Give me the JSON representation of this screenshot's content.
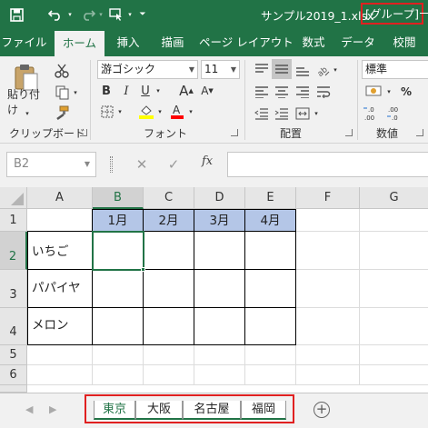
{
  "titlebar": {
    "file_name": "サンプル2019_1.xlsx",
    "group_tag": "[グループ]"
  },
  "qat_icons": [
    "save-icon",
    "undo-icon",
    "redo-icon",
    "touch-mode-icon",
    "customize-qat-icon"
  ],
  "tabs": [
    {
      "label": "ファイル"
    },
    {
      "label": "ホーム",
      "active": true
    },
    {
      "label": "挿入"
    },
    {
      "label": "描画"
    },
    {
      "label": "ページ レイアウト"
    },
    {
      "label": "数式"
    },
    {
      "label": "データ"
    },
    {
      "label": "校閲"
    }
  ],
  "ribbon": {
    "clipboard": {
      "label": "クリップボード",
      "paste_label": "貼り付け"
    },
    "font": {
      "label": "フォント",
      "font_name": "游ゴシック",
      "font_size": "11",
      "bold": "B",
      "italic": "I",
      "underline": "U",
      "grow": "A",
      "shrink": "A"
    },
    "alignment": {
      "label": "配置"
    },
    "number": {
      "label": "数値",
      "format": "標準"
    },
    "colors": {
      "accent": "#217346",
      "highlight": "#ffff00",
      "font_color": "#ff0000",
      "header_fill": "#b4c6e7"
    }
  },
  "formula_bar": {
    "name_box": "B2",
    "fx": "fx",
    "formula": ""
  },
  "columns": [
    "A",
    "B",
    "C",
    "D",
    "E",
    "F",
    "G"
  ],
  "rows": [
    "1",
    "2",
    "3",
    "4",
    "5",
    "6"
  ],
  "selected": {
    "column": "B",
    "row": "2"
  },
  "table": {
    "headers": [
      "1月",
      "2月",
      "3月",
      "4月"
    ],
    "items": [
      "いちご",
      "パパイヤ",
      "メロン"
    ]
  },
  "sheets": [
    {
      "name": "東京",
      "active": true
    },
    {
      "name": "大阪"
    },
    {
      "name": "名古屋"
    },
    {
      "name": "福岡"
    }
  ],
  "add_sheet": "⊕"
}
